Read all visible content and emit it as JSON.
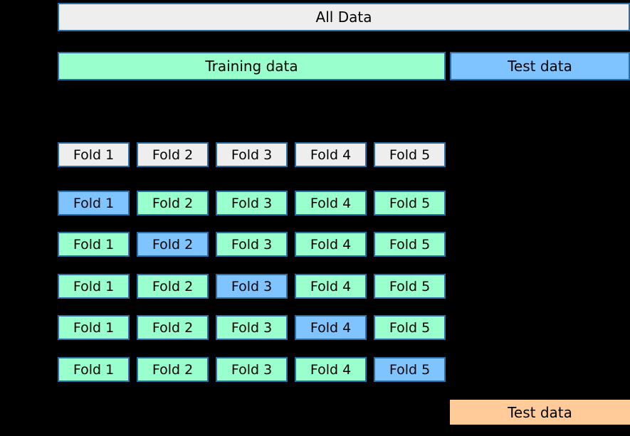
{
  "top": {
    "all_data": "All Data",
    "training_data": "Training data",
    "test_data": "Test data"
  },
  "fold_header": {
    "labels": [
      "Fold 1",
      "Fold 2",
      "Fold 3",
      "Fold 4",
      "Fold 5"
    ]
  },
  "splits": [
    {
      "labels": [
        "Fold 1",
        "Fold 2",
        "Fold 3",
        "Fold 4",
        "Fold 5"
      ],
      "validation_index": 0
    },
    {
      "labels": [
        "Fold 1",
        "Fold 2",
        "Fold 3",
        "Fold 4",
        "Fold 5"
      ],
      "validation_index": 1
    },
    {
      "labels": [
        "Fold 1",
        "Fold 2",
        "Fold 3",
        "Fold 4",
        "Fold 5"
      ],
      "validation_index": 2
    },
    {
      "labels": [
        "Fold 1",
        "Fold 2",
        "Fold 3",
        "Fold 4",
        "Fold 5"
      ],
      "validation_index": 3
    },
    {
      "labels": [
        "Fold 1",
        "Fold 2",
        "Fold 3",
        "Fold 4",
        "Fold 5"
      ],
      "validation_index": 4
    }
  ],
  "final_test": "Test data",
  "colors": {
    "gray": "#eeeeee",
    "green": "#99ffcc",
    "blue": "#80c4ff",
    "orange": "#ffcc99",
    "border": "#2b6fa8"
  }
}
